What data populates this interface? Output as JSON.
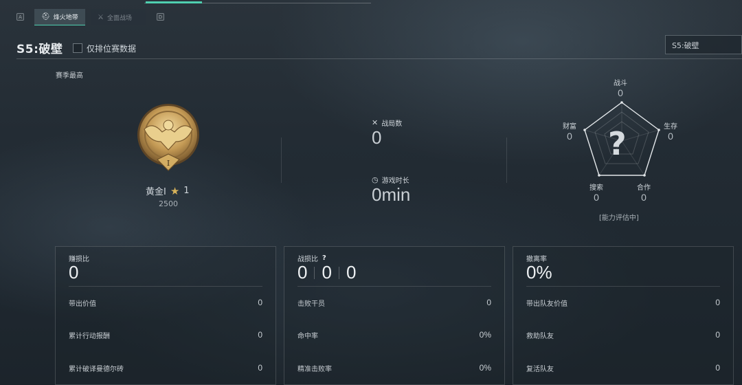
{
  "tabs": {
    "left_key": "A",
    "right_key": "D",
    "items": [
      {
        "label": "烽火地带",
        "icon": "helmet-icon",
        "active": true
      },
      {
        "label": "全面战场",
        "icon": "crossed-guns-icon",
        "active": false
      }
    ]
  },
  "header": {
    "season_title": "S5:破壁",
    "ranked_only_label": "仅排位赛数据",
    "season_select_value": "S5:破壁"
  },
  "season_best": {
    "label": "赛季最高",
    "rank_name": "黄金I",
    "rank_stars": "1",
    "rank_points": "2500",
    "medal_numeral": "I"
  },
  "center_stats": {
    "matches_label": "战局数",
    "matches_value": "0",
    "playtime_label": "游戏时长",
    "playtime_value": "0min"
  },
  "radar": {
    "top": {
      "label": "战斗",
      "value": "0"
    },
    "right": {
      "label": "生存",
      "value": "0"
    },
    "bottom_right": {
      "label": "合作",
      "value": "0"
    },
    "bottom_left": {
      "label": "搜索",
      "value": "0"
    },
    "left": {
      "label": "财富",
      "value": "0"
    },
    "placeholder": "?",
    "status": "[能力评估中]"
  },
  "panels": {
    "profit": {
      "title": "赚损比",
      "value": "0",
      "rows": [
        {
          "label": "带出价值",
          "value": "0"
        },
        {
          "label": "累计行动报酬",
          "value": "0"
        },
        {
          "label": "累计破译曼德尔砖",
          "value": "0"
        }
      ]
    },
    "kd": {
      "title": "战损比",
      "help": "?",
      "values": [
        "0",
        "0",
        "0"
      ],
      "rows": [
        {
          "label": "击败干员",
          "value": "0"
        },
        {
          "label": "命中率",
          "value": "0%"
        },
        {
          "label": "精准击败率",
          "value": "0%"
        }
      ]
    },
    "extract": {
      "title": "撤离率",
      "value": "0%",
      "rows": [
        {
          "label": "带出队友价值",
          "value": "0"
        },
        {
          "label": "救助队友",
          "value": "0"
        },
        {
          "label": "复活队友",
          "value": "0"
        }
      ]
    }
  },
  "colors": {
    "accent": "#4fd0b0",
    "gold": "#c9a55a",
    "background": "#232c34"
  }
}
